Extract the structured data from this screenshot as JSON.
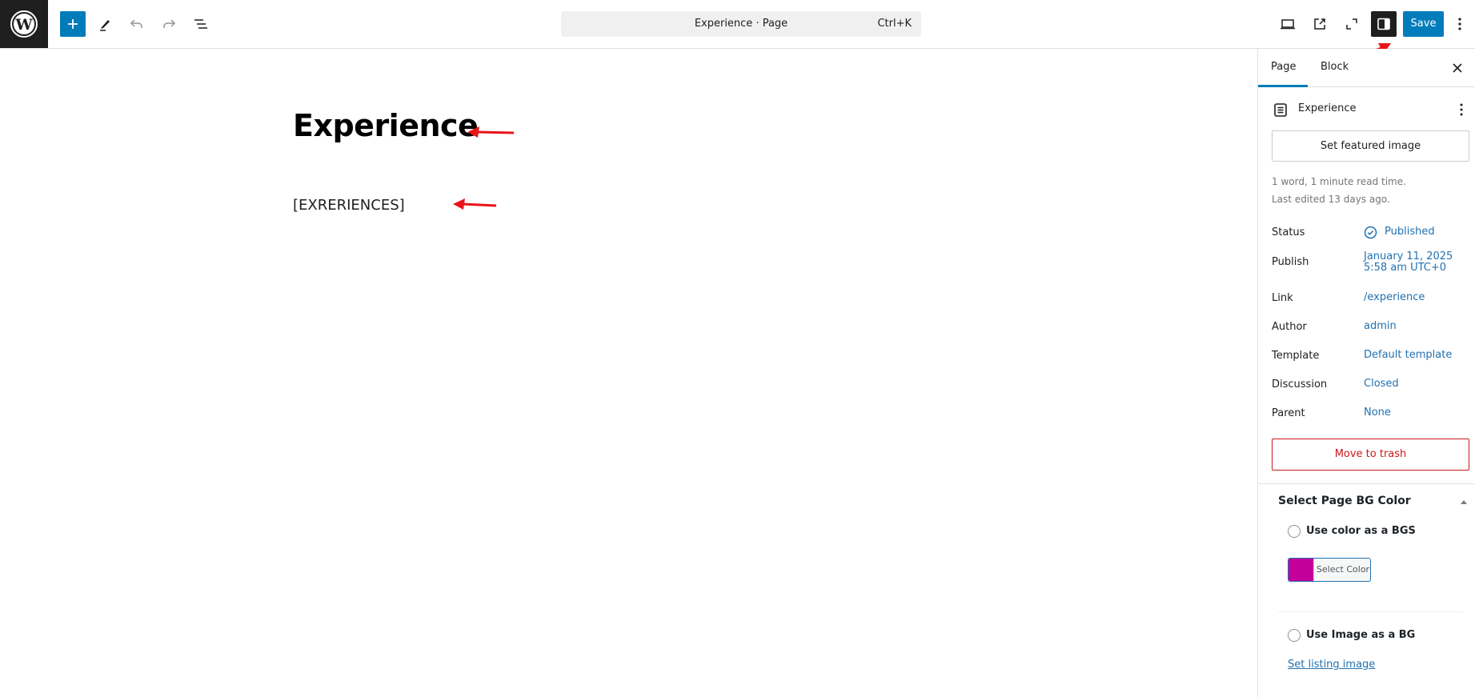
{
  "header": {
    "add_block_label": "Add block",
    "command_bar": {
      "title": "Experience · Page",
      "shortcut": "Ctrl+K"
    },
    "save_label": "Save",
    "icons": {
      "logo": "wordpress-logo-icon",
      "add": "plus-icon",
      "tools": "pencil-icon",
      "undo": "undo-icon",
      "redo": "redo-icon",
      "list_view": "list-view-icon",
      "preview": "desktop-preview-icon",
      "view_page": "external-link-icon",
      "fullscreen": "fullscreen-icon",
      "settings": "sidebar-toggle-icon",
      "options": "vertical-dots-icon"
    }
  },
  "editor": {
    "title": "Experience",
    "content": "[EXRERIENCES]"
  },
  "sidebar": {
    "tabs": [
      {
        "label": "Page",
        "active": true
      },
      {
        "label": "Block",
        "active": false
      }
    ],
    "post": {
      "name": "Experience"
    },
    "featured_image_label": "Set featured image",
    "stats": {
      "read_time": "1 word, 1 minute read time.",
      "last_edited": "Last edited 13 days ago."
    },
    "fields": [
      {
        "label": "Status",
        "value": "Published"
      },
      {
        "label": "Publish",
        "value": "January 11, 2025",
        "value2": "5:58 am UTC+0"
      },
      {
        "label": "Link",
        "value": "/experience"
      },
      {
        "label": "Author",
        "value": "admin"
      },
      {
        "label": "Template",
        "value": "Default template"
      },
      {
        "label": "Discussion",
        "value": "Closed"
      },
      {
        "label": "Parent",
        "value": "None"
      }
    ],
    "trash_label": "Move to trash",
    "metabox": {
      "title": "Select Page BG Color",
      "options": [
        {
          "label": "Use color as a BGS",
          "checked": false
        },
        {
          "label": "Use Image as a BG",
          "checked": false
        }
      ],
      "color_picker_label": "Select Color",
      "selected_color": "#c4009b",
      "listing_link": "Set listing image"
    }
  },
  "colors": {
    "accent": "#007cba",
    "link": "#2271b1",
    "danger": "#cc1818",
    "annotation": "#e8141a"
  }
}
